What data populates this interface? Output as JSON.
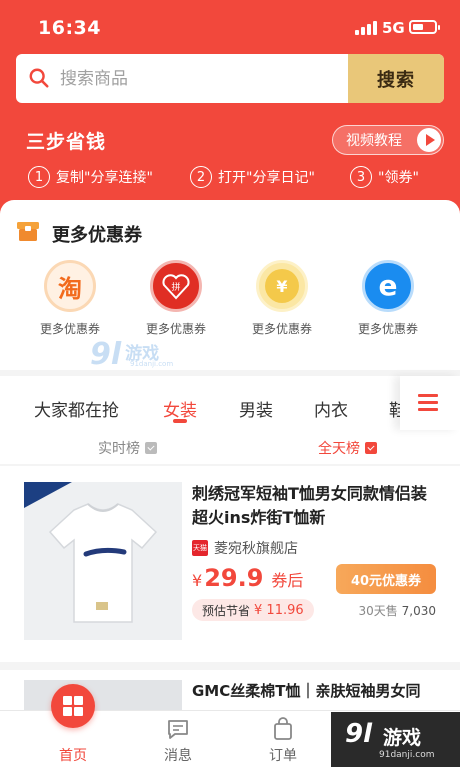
{
  "status_bar": {
    "time": "16:34",
    "network": "5G"
  },
  "search": {
    "placeholder": "搜索商品",
    "button_label": "搜索"
  },
  "steps": {
    "title": "三步省钱",
    "video_label": "视频教程",
    "items": [
      {
        "num": "1",
        "text": "复制\"分享连接\""
      },
      {
        "num": "2",
        "text": "打开\"分享日记\""
      },
      {
        "num": "3",
        "text": "\"领券\""
      }
    ]
  },
  "coupons": {
    "title": "更多优惠券",
    "items": [
      {
        "glyph": "淘",
        "label": "更多优惠券"
      },
      {
        "glyph": "拼",
        "label": "更多优惠券"
      },
      {
        "glyph": "¥",
        "label": "更多优惠券"
      },
      {
        "glyph": "e",
        "label": "更多优惠券"
      }
    ]
  },
  "watermark_top": {
    "mark": "9l",
    "text": "游戏",
    "url": "91danji.com"
  },
  "tabs": {
    "items": [
      "大家都在抢",
      "女装",
      "男装",
      "内衣",
      "鞋"
    ],
    "active": "女装",
    "rank_left": "实时榜",
    "rank_right": "全天榜"
  },
  "product": {
    "title": "刺绣冠军短袖T恤男女同款情侣装超火ins炸街T恤新",
    "shop": "菱宛秋旗舰店",
    "shop_badge": "天猫",
    "currency": "¥",
    "price": "29.9",
    "price_suffix": "券后",
    "coupon": "40元优惠券",
    "save_label": "预估节省",
    "save_amount": "¥ 11.96",
    "sales_label": "30天售",
    "sales_value": "7,030"
  },
  "product2": {
    "title": "GMC丝柔棉T恤｜亲肤短袖男女同"
  },
  "bottom_nav": {
    "home": "首页",
    "messages": "消息",
    "orders": "订单"
  },
  "watermark": {
    "mark": "9l",
    "text": "游戏",
    "url": "91danji.com"
  },
  "colors": {
    "brand_red": "#f2483c",
    "search_gold": "#e9c779",
    "coupon_orange": "#f58d3f"
  }
}
